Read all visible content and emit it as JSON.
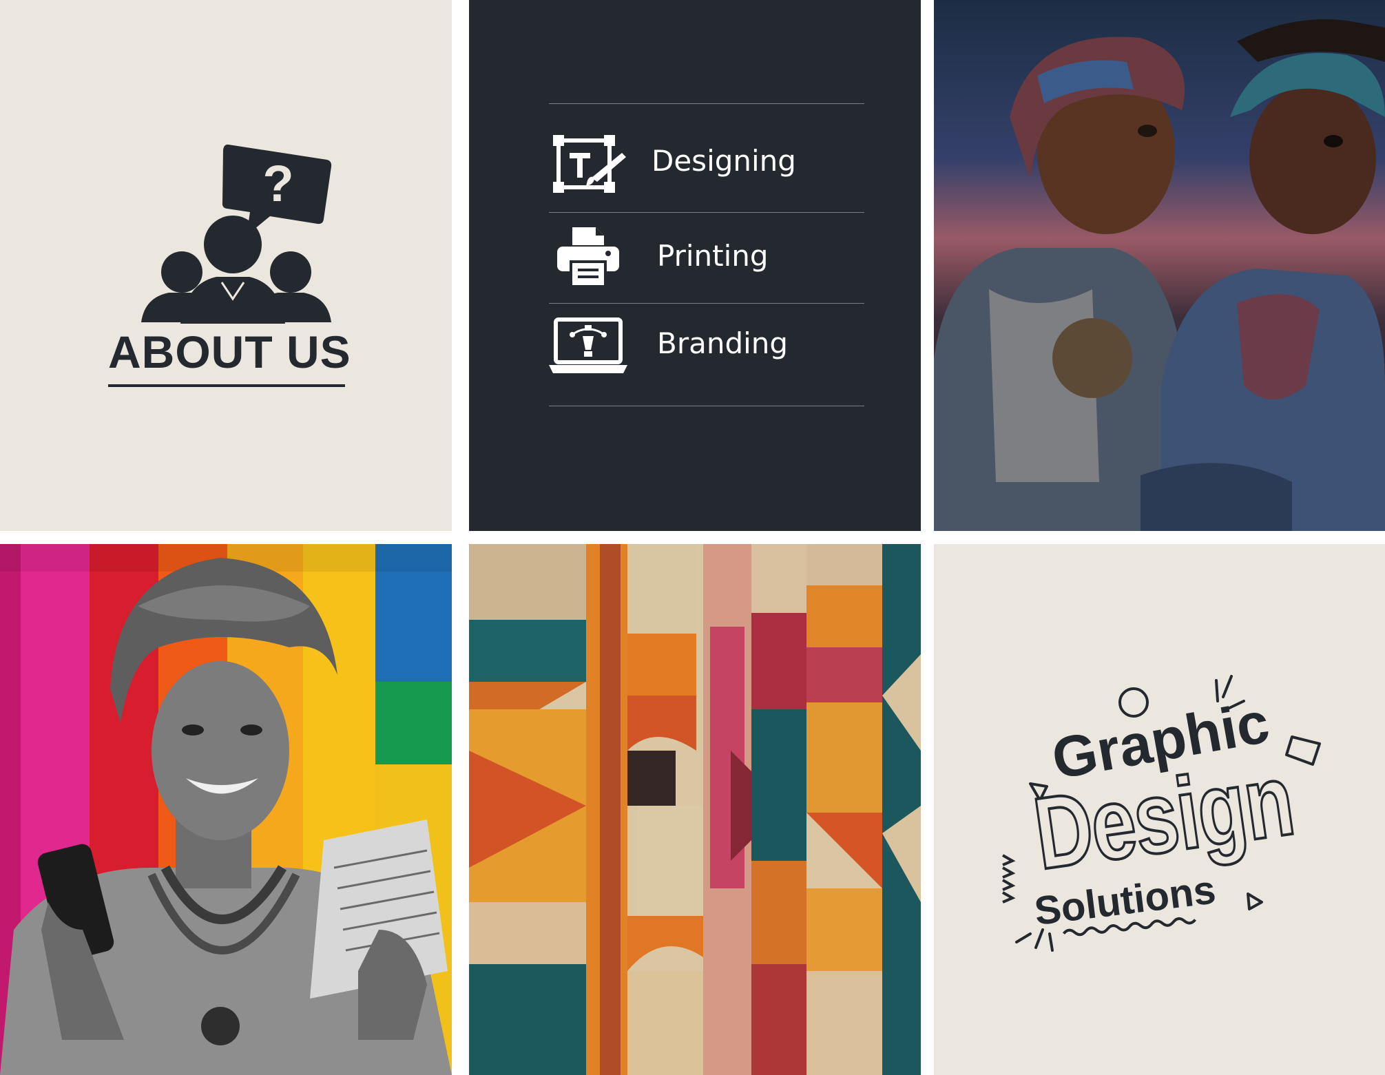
{
  "about": {
    "title": "ABOUT US"
  },
  "services": {
    "items": [
      {
        "label": "Designing",
        "icon": "design-tool-icon"
      },
      {
        "label": "Printing",
        "icon": "printer-icon"
      },
      {
        "label": "Branding",
        "icon": "laptop-vector-icon"
      }
    ]
  },
  "graphic": {
    "line1": "Graphic",
    "line2": "Design",
    "line3": "Solutions"
  },
  "colors": {
    "dark": "#24282f",
    "cream": "#ece7de"
  }
}
